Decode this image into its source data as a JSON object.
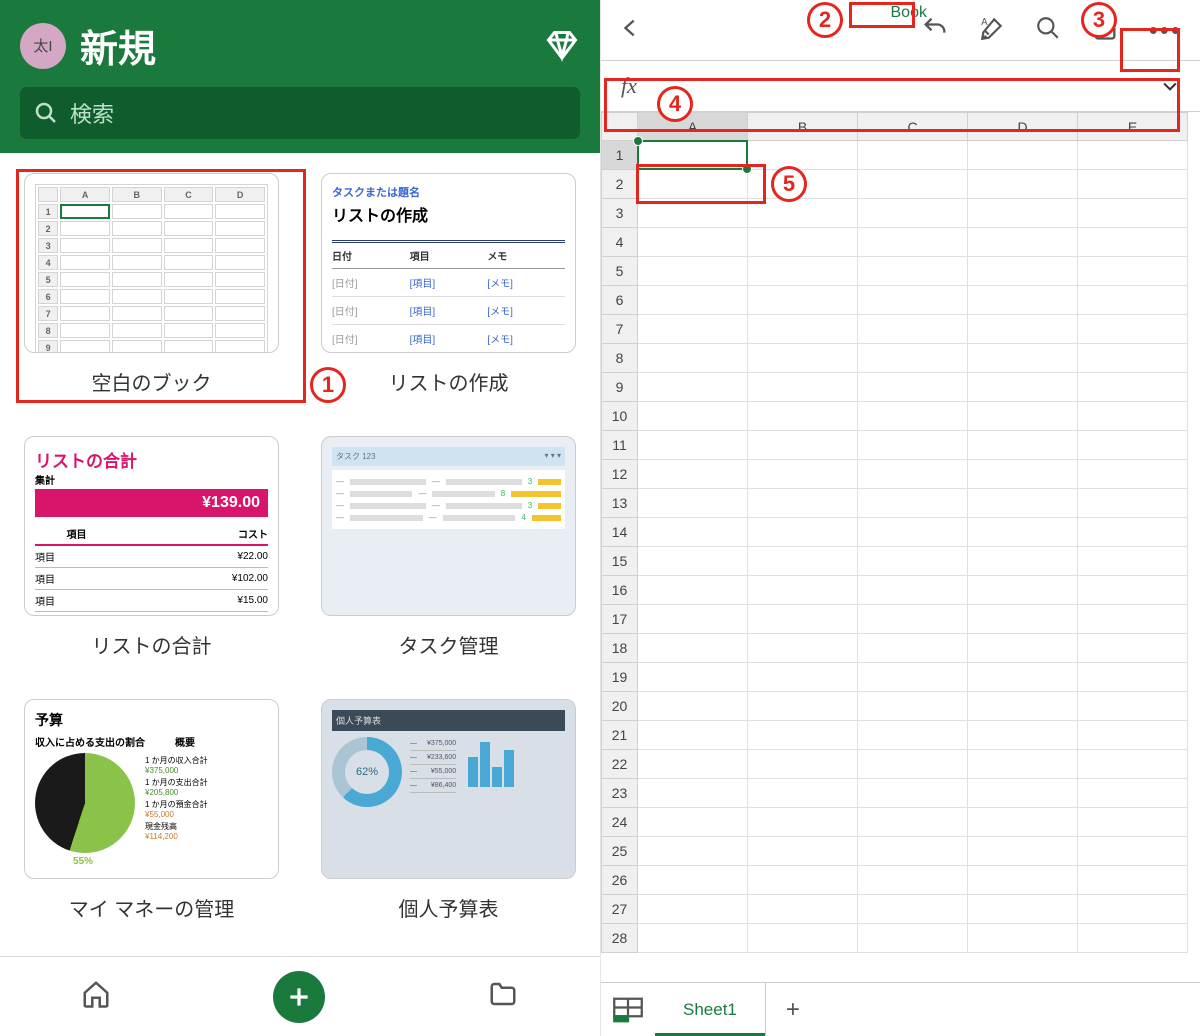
{
  "left": {
    "avatar_initials": "太I",
    "title": "新規",
    "search_placeholder": "検索",
    "templates": [
      {
        "label": "空白のブック"
      },
      {
        "label": "リストの作成",
        "task_heading": "タスクまたは題名",
        "subtitle": "リストの作成",
        "cols": [
          "日付",
          "項目",
          "メモ"
        ],
        "ph": [
          "[日付]",
          "[項目]",
          "[メモ]"
        ]
      },
      {
        "label": "リストの合計",
        "title": "リストの合計",
        "sub": "集計",
        "total": "¥139.00",
        "cols": [
          "項目",
          "コスト"
        ],
        "rows": [
          [
            "項目",
            "¥22.00"
          ],
          [
            "項目",
            "¥102.00"
          ],
          [
            "項目",
            "¥15.00"
          ]
        ]
      },
      {
        "label": "タスク管理",
        "header": "タスク 123",
        "nums": [
          "3",
          "8",
          "3",
          "4"
        ]
      },
      {
        "label": "マイ マネーの管理",
        "title": "予算",
        "sub1": "収入に占める支出の割合",
        "sub2": "概要",
        "pct": "55%",
        "lines": [
          [
            "1 か月の収入合計",
            "¥375,000"
          ],
          [
            "1 か月の支出合計",
            "¥205,800"
          ],
          [
            "1 か月の預金合計",
            "¥55,000"
          ],
          [
            "現金残高",
            "¥114,200"
          ]
        ]
      },
      {
        "label": "個人予算表",
        "header": "個人予算表",
        "pct": "62%",
        "lines": [
          [
            "",
            "¥375,000"
          ],
          [
            "",
            "¥233,600"
          ],
          [
            "",
            "¥55,000"
          ],
          [
            "",
            "¥86,400"
          ]
        ]
      }
    ]
  },
  "right": {
    "doc_title": "Book",
    "fx_label": "fx",
    "columns": [
      "A",
      "B",
      "C",
      "D",
      "E"
    ],
    "rows_count": 28,
    "selected_cell": "A1",
    "sheet_name": "Sheet1"
  },
  "annotations": {
    "n1": "1",
    "n2": "2",
    "n3": "3",
    "n4": "4",
    "n5": "5"
  }
}
